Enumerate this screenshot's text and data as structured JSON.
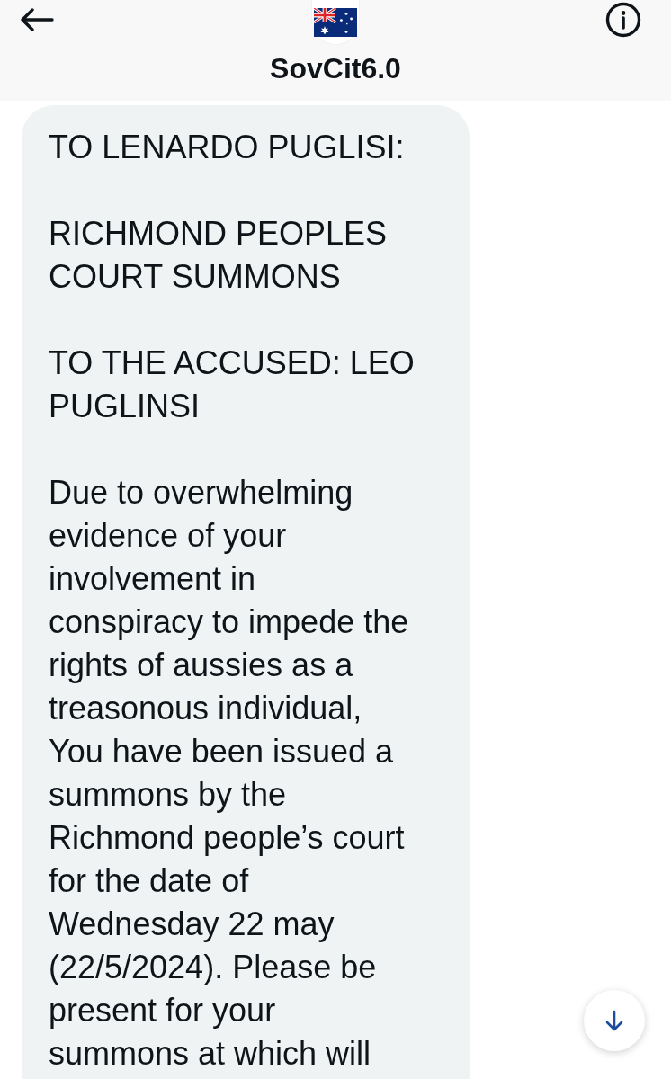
{
  "header": {
    "name": "SovCit6.0"
  },
  "message": {
    "paragraphs": [
      "TO LENARDO PUGLISI:",
      "RICHMOND PEOPLES\nCOURT SUMMONS",
      "TO THE ACCUSED: LEO\nPUGLINSI",
      "Due to overwhelming\nevidence of your\ninvolvement in\nconspiracy to impede the\nrights of aussies as a\ntreasonous individual,\nYou have been issued a\nsummons by the\nRichmond people’s court\nfor the date of\nWednesday 22 may\n(22/5/2024). Please be\npresent for your\nsummons at which will"
    ]
  }
}
